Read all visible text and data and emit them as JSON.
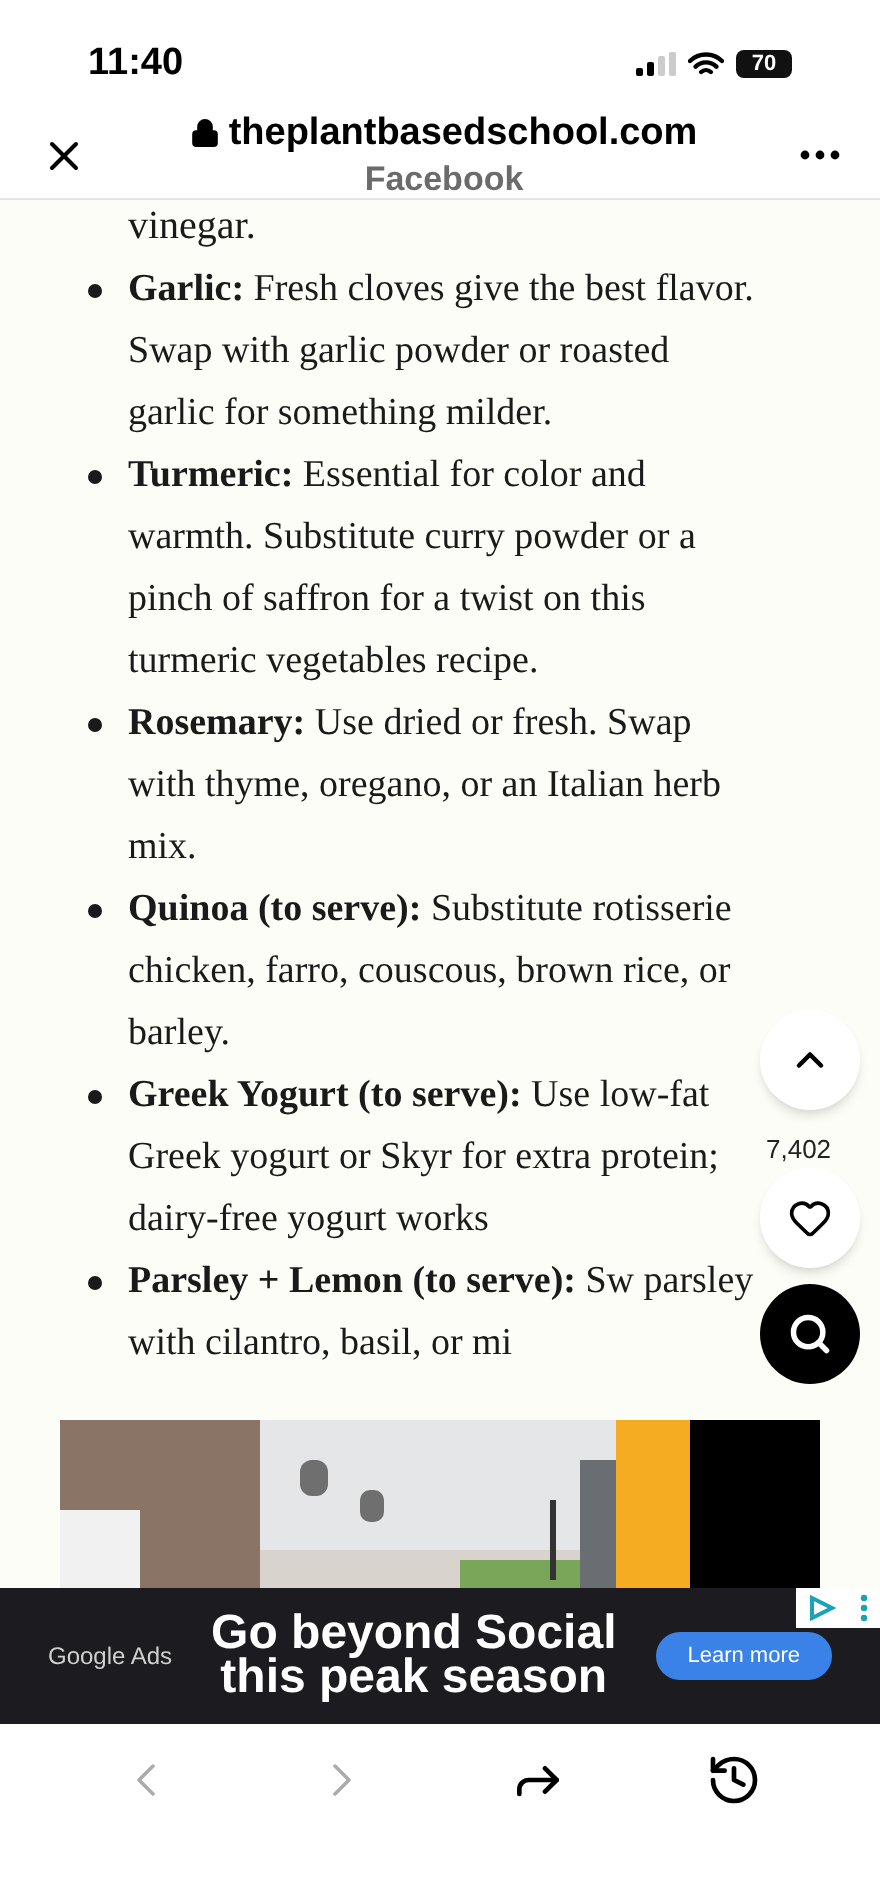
{
  "status_bar": {
    "time": "11:40",
    "battery": "70"
  },
  "browser_bar": {
    "domain": "theplantbasedschool.com",
    "source": "Facebook"
  },
  "article": {
    "lead_in": "vinegar.",
    "items": [
      {
        "term": "Garlic:",
        "text": "Fresh cloves give the best flavor. Swap with garlic powder or roasted garlic for something milder."
      },
      {
        "term": "Turmeric:",
        "text": "Essential for color and warmth. Substitute curry powder or a pinch of saffron for a twist on this turmeric vegetables recipe."
      },
      {
        "term": "Rosemary:",
        "text": "Use dried or fresh. Swap with thyme, oregano, or an Italian herb mix."
      },
      {
        "term": "Quinoa (to serve):",
        "text": "Substitute rotisserie chicken, farro, couscous, brown rice, or barley."
      },
      {
        "term": "Greek Yogurt (to serve):",
        "text": "Use low-fat Greek yogurt or Skyr for extra protein; dairy-free yogurt works"
      },
      {
        "term": "Parsley + Lemon (to serve):",
        "text": "Sw parsley with cilantro, basil, or mi"
      }
    ]
  },
  "floating": {
    "like_count": "7,402"
  },
  "ad": {
    "brand": "Google Ads",
    "headline": "Go beyond Social this peak season",
    "cta": "Learn more"
  }
}
